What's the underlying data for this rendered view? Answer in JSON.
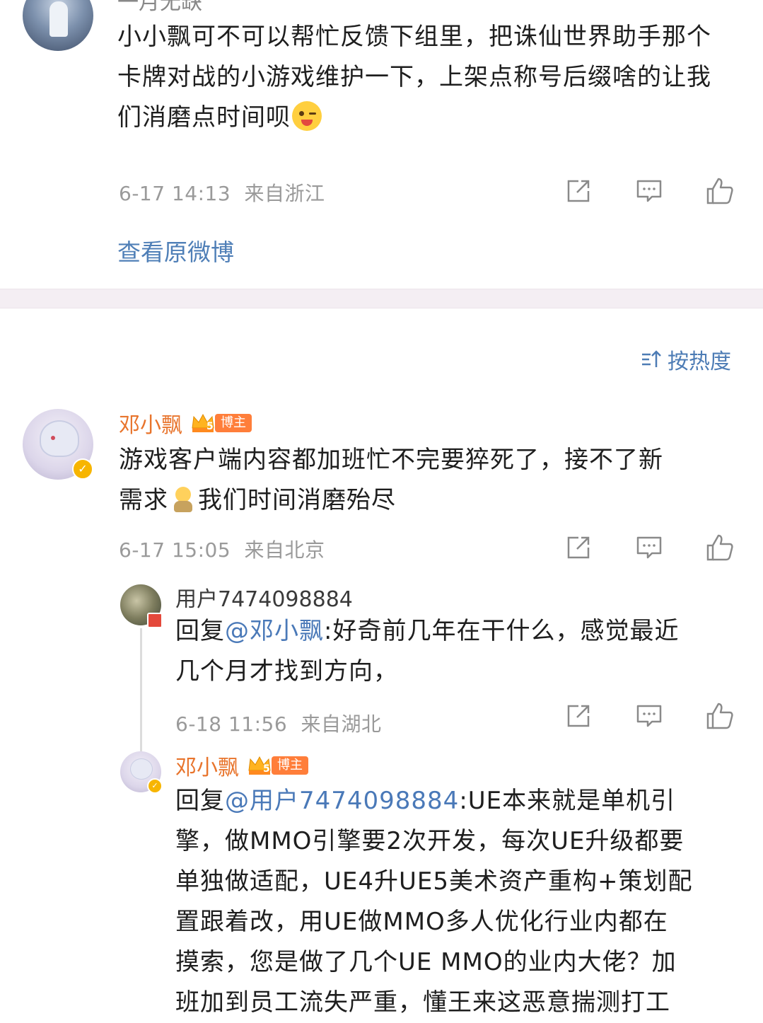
{
  "top_post": {
    "username_partial": "一月无缺",
    "text": "小小飘可不可以帮忙反馈下组里，把诛仙世界助手那个卡牌对战的小游戏维护一下，上架点称号后缀啥的让我们消磨点时间呗",
    "emoji_name": "wink-tongue-emoji",
    "timestamp": "6-17 14:13",
    "location": "来自浙江",
    "view_original": "查看原微博"
  },
  "sort": {
    "label": "按热度",
    "icon": "sort-icon"
  },
  "comment_main": {
    "username": "邓小飘",
    "badge_level": "5",
    "badge_label": "博主",
    "text_line1": "游戏客户端内容都加班忙不完要猝死了，接不了新",
    "text_line2_a": "需求",
    "text_line2_b": "我们时间消磨殆尽",
    "emoji_name": "exhausted-emoji",
    "timestamp": "6-17 15:05",
    "location": "来自北京"
  },
  "reply_1": {
    "username": "用户7474098884",
    "reply_prefix": "回复",
    "mention": "@邓小飘",
    "text_rest": ":好奇前几年在干什么，感觉最近",
    "text_line2": "几个月才找到方向，",
    "timestamp": "6-18 11:56",
    "location": "来自湖北"
  },
  "reply_2": {
    "username": "邓小飘",
    "badge_level": "5",
    "badge_label": "博主",
    "reply_prefix": "回复",
    "mention": "@用户7474098884",
    "text_line1_rest": ":UE本来就是单机引",
    "lines": [
      "擎，做MMO引擎要2次开发，每次UE升级都要",
      "单独做适配，UE4升UE5美术资产重构+策划配",
      "置跟着改，用UE做MMO多人优化行业内都在",
      "摸索，您是做了几个UE MMO的业内大佬？加",
      "班加到员工流失严重，懂王来这恶意揣测打工"
    ]
  },
  "colors": {
    "author_name": "#e8742c",
    "mention": "#4a79b8",
    "meta": "#9a9a9a",
    "divider": "#f4eef3",
    "badge": "#ff7e3a"
  }
}
